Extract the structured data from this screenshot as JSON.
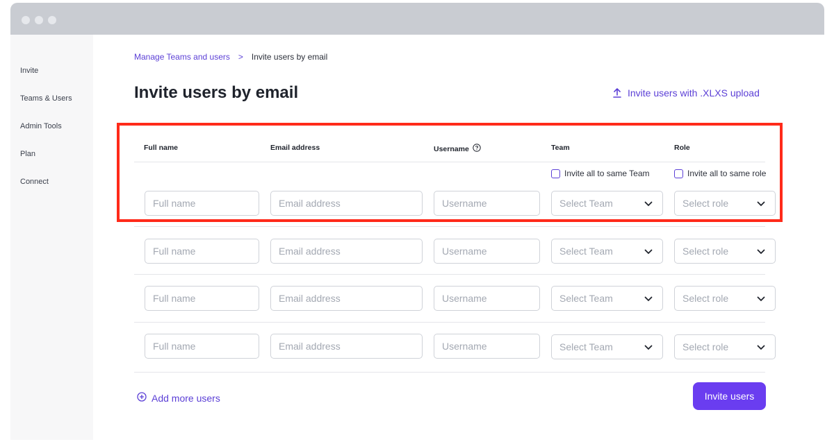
{
  "sidebar": {
    "items": [
      {
        "label": "Invite"
      },
      {
        "label": "Teams & Users"
      },
      {
        "label": "Admin Tools"
      },
      {
        "label": "Plan"
      },
      {
        "label": "Connect"
      }
    ]
  },
  "breadcrumb": {
    "parent": "Manage Teams and users",
    "separator": ">",
    "current": "Invite users by email"
  },
  "header": {
    "title": "Invite users by email",
    "upload_label": "Invite users with .XLXS upload"
  },
  "form": {
    "columns": {
      "full_name": "Full name",
      "email": "Email address",
      "username": "Username",
      "team": "Team",
      "role": "Role"
    },
    "same_team_label": "Invite all to same Team",
    "same_role_label": "Invite all to same role",
    "placeholders": {
      "full_name": "Full name",
      "email": "Email address",
      "username": "Username",
      "team": "Select Team",
      "role": "Select role"
    },
    "rows": 4
  },
  "actions": {
    "add_more": "Add more users",
    "invite": "Invite users"
  },
  "colors": {
    "accent": "#6a3df0",
    "link": "#5b3fd6",
    "highlight": "#ff2a1a"
  }
}
